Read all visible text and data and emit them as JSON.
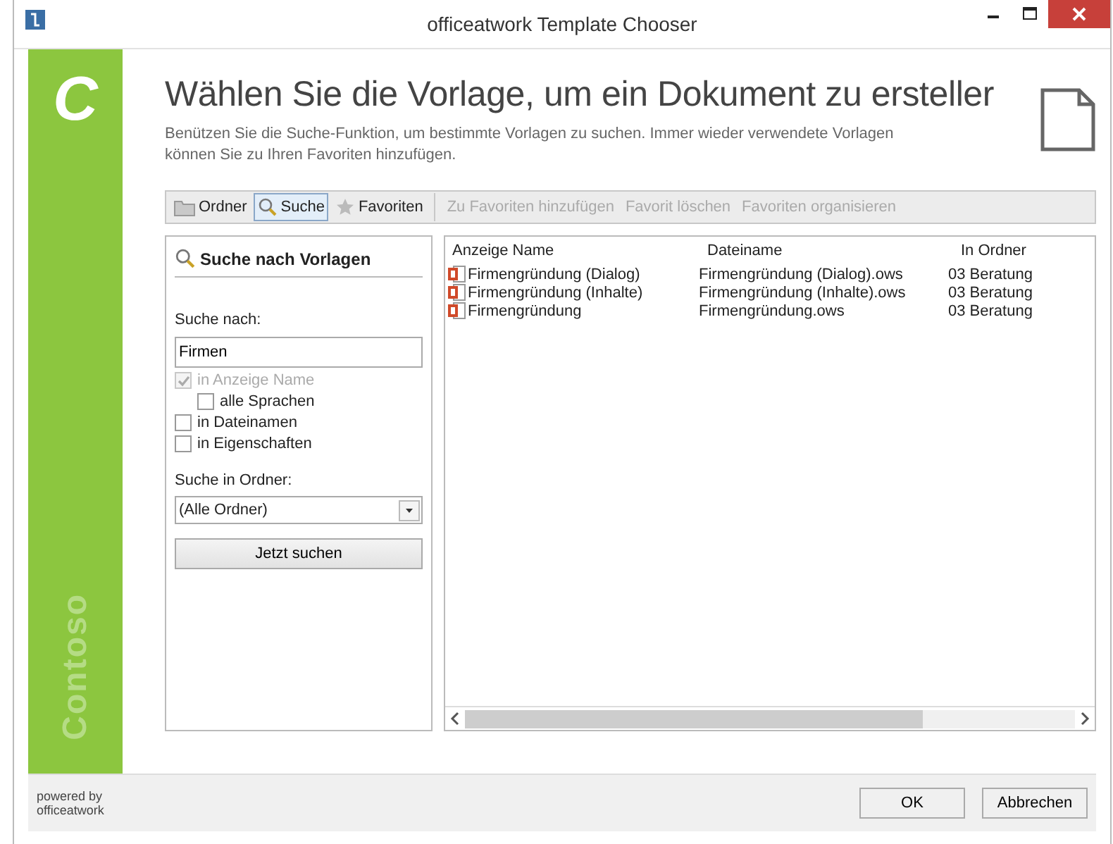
{
  "window": {
    "title": "officeatwork Template Chooser"
  },
  "sidebar": {
    "logo": "C",
    "brand": "Contoso"
  },
  "heading": "Wählen Sie die Vorlage, um ein Dokument zu ersteller",
  "description": "Benützen Sie die Suche-Funktion, um bestimmte Vorlagen zu suchen. Immer wieder verwendete Vorlagen können Sie zu Ihren Favoriten hinzufügen.",
  "toolbar": [
    {
      "label": "Ordner",
      "kind": "folder",
      "selected": false,
      "disabled": false
    },
    {
      "label": "Suche",
      "kind": "search",
      "selected": true,
      "disabled": false
    },
    {
      "label": "Favoriten",
      "kind": "star",
      "selected": false,
      "disabled": false
    },
    {
      "label": "Zu Favoriten hinzufügen",
      "kind": "text",
      "selected": false,
      "disabled": true
    },
    {
      "label": "Favorit löschen",
      "kind": "text",
      "selected": false,
      "disabled": true
    },
    {
      "label": "Favoriten organisieren",
      "kind": "text",
      "selected": false,
      "disabled": true
    }
  ],
  "search_panel": {
    "title": "Suche nach Vorlagen",
    "search_label": "Suche nach:",
    "query": "Firmen",
    "options": [
      {
        "label": "in Anzeige Name",
        "checked": true,
        "disabled": true,
        "children": [
          {
            "label": "alle Sprachen",
            "checked": false,
            "disabled": false
          }
        ]
      },
      {
        "label": "in Dateinamen",
        "checked": false,
        "disabled": false
      },
      {
        "label": "in Eigenschaften",
        "checked": false,
        "disabled": false
      }
    ],
    "folder_label": "Suche in Ordner:",
    "folder": "(Alle Ordner)",
    "button": "Jetzt suchen"
  },
  "table": {
    "columns": [
      "Anzeige Name",
      "Dateiname",
      "In Ordner"
    ],
    "rows": [
      [
        "Firmengründung (Dialog)",
        "Firmengründung (Dialog).ows",
        "03 Beratung"
      ],
      [
        "Firmengründung (Inhalte)",
        "Firmengründung (Inhalte).ows",
        "03 Beratung"
      ],
      [
        "Firmengründung",
        "Firmengründung.ows",
        "03 Beratung"
      ]
    ]
  },
  "footer": {
    "powered_by": "powered by officeatwork",
    "buttons": [
      "OK",
      "Abbrechen"
    ]
  }
}
